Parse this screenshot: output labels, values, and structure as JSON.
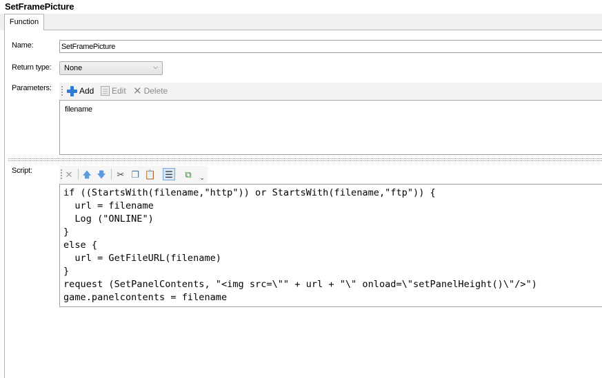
{
  "window": {
    "title": "SetFramePicture"
  },
  "tabs": [
    {
      "label": "Function"
    }
  ],
  "form": {
    "name_label": "Name:",
    "name_value": "SetFramePicture",
    "return_label": "Return type:",
    "return_value": "None",
    "params_label": "Parameters:",
    "script_label": "Script:"
  },
  "parameters": {
    "toolbar": {
      "add": "Add",
      "edit": "Edit",
      "delete": "Delete"
    },
    "items": [
      "filename"
    ]
  },
  "script_toolbar": {
    "icons": [
      "delete-icon",
      "move-up-icon",
      "move-down-icon",
      "cut-icon",
      "copy-icon",
      "paste-icon",
      "code-view-icon",
      "popout-icon",
      "overflow-icon"
    ]
  },
  "script": {
    "lines": [
      "if ((StartsWith(filename,\"http\")) or StartsWith(filename,\"ftp\")) {",
      "  url = filename",
      "  Log (\"ONLINE\")",
      "}",
      "else {",
      "  url = GetFileURL(filename)",
      "}",
      "request (SetPanelContents, \"<img src=\\\"\" + url + \"\\\" onload=\\\"setPanelHeight()\\\"/>\")",
      "game.panelcontents = filename"
    ]
  },
  "colors": {
    "accent": "#2e7bd6",
    "border": "#a0a0a0",
    "toolbar_bg": "#f3f3f3"
  }
}
